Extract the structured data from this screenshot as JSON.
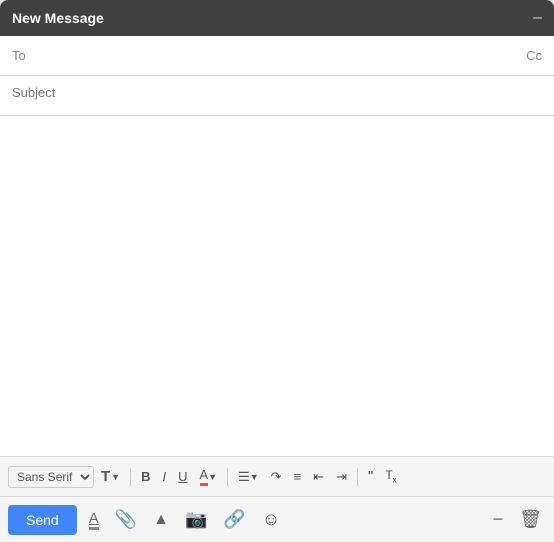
{
  "window": {
    "title": "New Message",
    "minimize_label": "–"
  },
  "header": {
    "to_label": "To",
    "cc_label": "Cc",
    "subject_label": "Subject",
    "to_placeholder": "",
    "subject_placeholder": ""
  },
  "toolbar": {
    "font_family": "Sans Serif",
    "font_size_label": "T",
    "bold_label": "B",
    "italic_label": "I",
    "underline_label": "U",
    "font_color_label": "A",
    "align_label": "≡",
    "numbered_list_label": "≡",
    "bullet_list_label": "≡",
    "indent_label": "⇥",
    "outdent_label": "⇤",
    "quote_label": "❝",
    "clear_label": "Tx"
  },
  "bottom_toolbar": {
    "send_label": "Send",
    "formatting_label": "A",
    "attachment_label": "📎",
    "drive_label": "▲",
    "photo_label": "📷",
    "link_label": "🔗",
    "emoji_label": "☺",
    "minimize_label": "−",
    "delete_label": "🗑"
  },
  "icons": {
    "minimize": "−",
    "attachment": "attachment",
    "drive": "drive",
    "photo": "photo",
    "link": "link",
    "emoji": "emoji",
    "delete": "delete",
    "formatting": "formatting"
  }
}
